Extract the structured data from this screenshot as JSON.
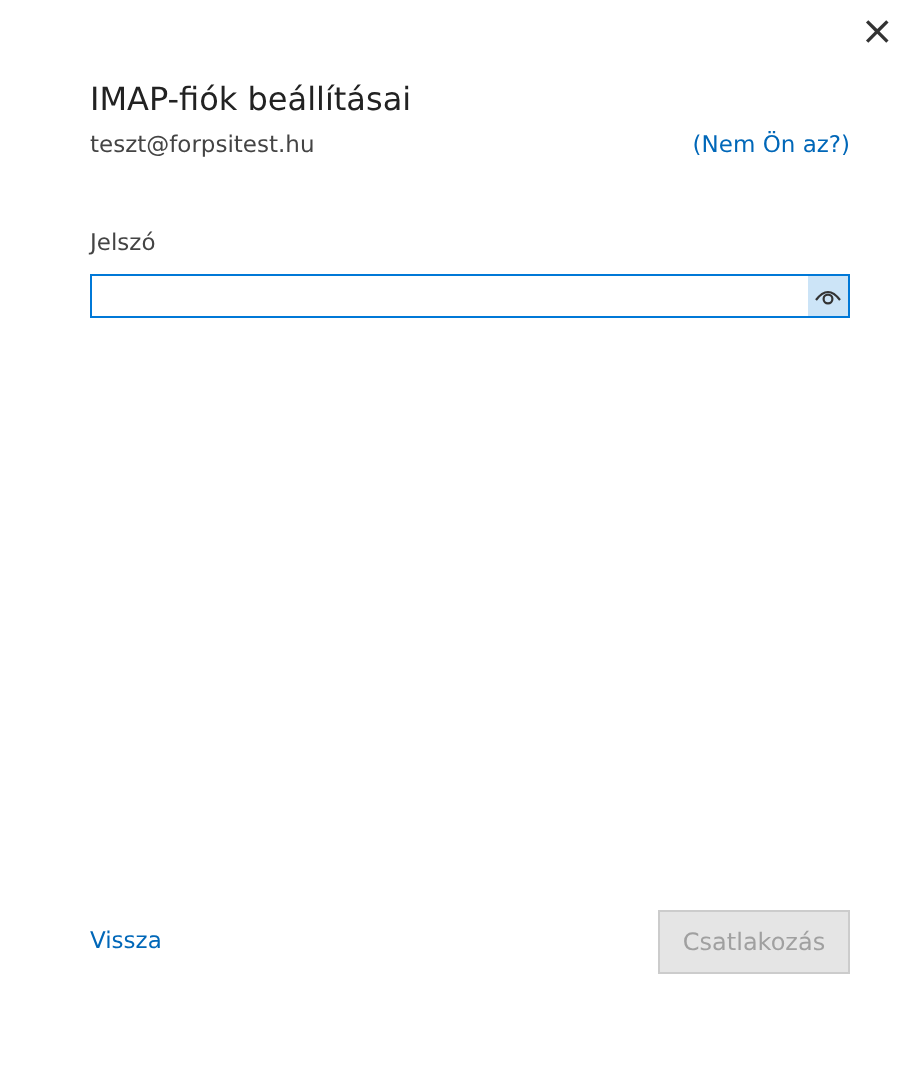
{
  "dialog": {
    "close": "×"
  },
  "title": "IMAP-fiók beállításai",
  "account": {
    "email": "teszt@forpsitest.hu",
    "switch_link": "(Nem Ön az?)"
  },
  "password": {
    "label": "Jelszó",
    "focused": true
  },
  "footer": {
    "back_link": "Vissza",
    "connect_button": {
      "label": "Csatlakozás",
      "disabled": true
    }
  }
}
